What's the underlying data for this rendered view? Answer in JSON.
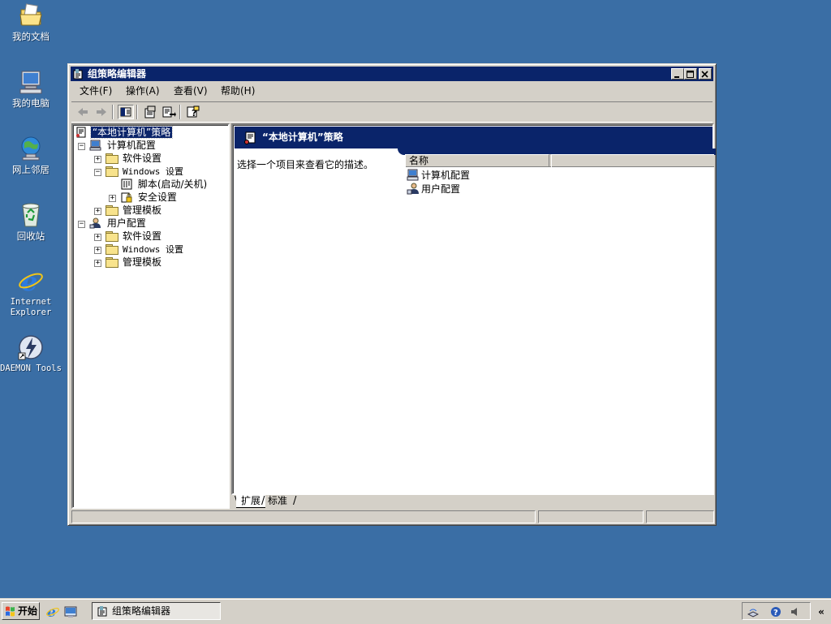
{
  "desktop": {
    "icons": [
      {
        "label": "我的文档",
        "icon": "my-documents-icon"
      },
      {
        "label": "我的电脑",
        "icon": "my-computer-icon"
      },
      {
        "label": "网上邻居",
        "icon": "network-places-icon"
      },
      {
        "label": "回收站",
        "icon": "recycle-bin-icon"
      },
      {
        "label": "Internet\nExplorer",
        "label_line1": "Internet",
        "label_line2": "Explorer",
        "icon": "internet-explorer-icon"
      },
      {
        "label": "DAEMON Tools",
        "icon": "daemon-tools-icon"
      }
    ]
  },
  "window": {
    "title": "组策略编辑器",
    "menu": [
      "文件(F)",
      "操作(A)",
      "查看(V)",
      "帮助(H)"
    ],
    "toolbar_icons": [
      "back-arrow-icon",
      "forward-arrow-icon",
      "show-hide-tree-icon",
      "properties-icon",
      "export-list-icon",
      "help-icon"
    ],
    "tree": {
      "root": "“本地计算机”策略",
      "computer_config": "计算机配置",
      "software_settings": "软件设置",
      "windows_settings": "Windows 设置",
      "scripts": "脚本(启动/关机)",
      "security_settings": "安全设置",
      "admin_templates": "管理模板",
      "user_config": "用户配置",
      "user_software_settings": "软件设置",
      "user_windows_settings": "Windows 设置",
      "user_admin_templates": "管理模板"
    },
    "banner_title": "“本地计算机”策略",
    "description": "选择一个项目来查看它的描述。",
    "list": {
      "column_name": "名称",
      "items": [
        "计算机配置",
        "用户配置"
      ]
    },
    "tabs": {
      "extended": "扩展",
      "standard": "标准"
    }
  },
  "taskbar": {
    "start_label": "开始",
    "task_label": "组策略编辑器",
    "chevron": "«"
  },
  "colors": {
    "desktop": "#3a6ea5",
    "titlebar": "#0a246a",
    "chrome": "#d4d0c8"
  }
}
